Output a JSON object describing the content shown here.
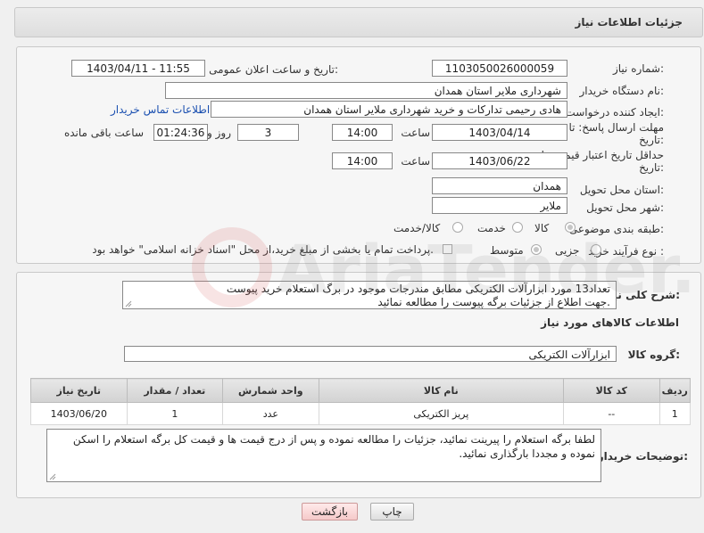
{
  "header": {
    "title": "جزئیات اطلاعات نیاز"
  },
  "form": {
    "need_number": {
      "label": "شماره نیاز:",
      "value": "1103050026000059"
    },
    "announce": {
      "label": "تاریخ و ساعت اعلان عمومی:",
      "value": "1403/04/11 - 11:55"
    },
    "buyer_org": {
      "label": "نام دستگاه خریدار:",
      "value": "شهرداری ملایر استان همدان"
    },
    "requester": {
      "label": "ایجاد کننده درخواست:",
      "value": "هادی رحیمی تدارکات و خرید شهرداری ملایر استان همدان",
      "contact_link": "اطلاعات تماس خریدار"
    },
    "reply_deadline": {
      "label1": "مهلت ارسال پاسخ: تا",
      "label2": "تاریخ:",
      "date": "1403/04/14",
      "time_label": "ساعت",
      "time": "14:00",
      "days": "3",
      "days_label": "روز و",
      "remaining": "01:24:36",
      "remaining_label": "ساعت باقی مانده"
    },
    "price_validity": {
      "label1": "حداقل تاریخ اعتبار قیمت: تا",
      "label2": "تاریخ:",
      "date": "1403/06/22",
      "time_label": "ساعت",
      "time": "14:00"
    },
    "delivery_province": {
      "label": "استان محل تحویل:",
      "value": "همدان"
    },
    "delivery_city": {
      "label": "شهر محل تحویل:",
      "value": "ملایر"
    },
    "category": {
      "label": "طبقه بندی موضوعی:",
      "options": [
        "کالا",
        "خدمت",
        "کالا/خدمت"
      ]
    },
    "process": {
      "label": "نوع فرآیند خرید :",
      "options": [
        "جزیی",
        "متوسط"
      ],
      "payment_note": "پرداخت تمام یا بخشی از مبلغ خرید،از محل \"اسناد خزانه اسلامی\" خواهد بود."
    }
  },
  "description": {
    "label": "شرح کلی نیاز:",
    "line1": "تعداد13 مورد ابزارآلات الکتریکی مطابق مندرجات موجود در برگ استعلام خرید پیوست",
    "line2": "جهت اطلاع از جزئیات برگه پیوست را مطالعه نمائید."
  },
  "goods": {
    "section_title": "اطلاعات کالاهای مورد نیاز",
    "group_label": "گروه کالا:",
    "group_value": "ابزارآلات الکتریکی",
    "columns": [
      "ردیف",
      "کد کالا",
      "نام کالا",
      "واحد شمارش",
      "تعداد / مقدار",
      "تاریخ نیاز"
    ],
    "rows": [
      [
        "1",
        "--",
        "پریز الکتریکی",
        "عدد",
        "1",
        "1403/06/20"
      ]
    ]
  },
  "buyer_notes": {
    "label": "توضیحات خریدار:",
    "text": "لطفا برگه استعلام را پیرینت نمائید، جزئیات را مطالعه نموده و پس از درج قیمت ها و قیمت کل برگه استعلام را اسکن نموده و مجددا بارگذاری نمائید."
  },
  "buttons": {
    "print": "چاپ",
    "back": "بازگشت"
  },
  "watermark": {
    "text": "AriaTender.net"
  }
}
